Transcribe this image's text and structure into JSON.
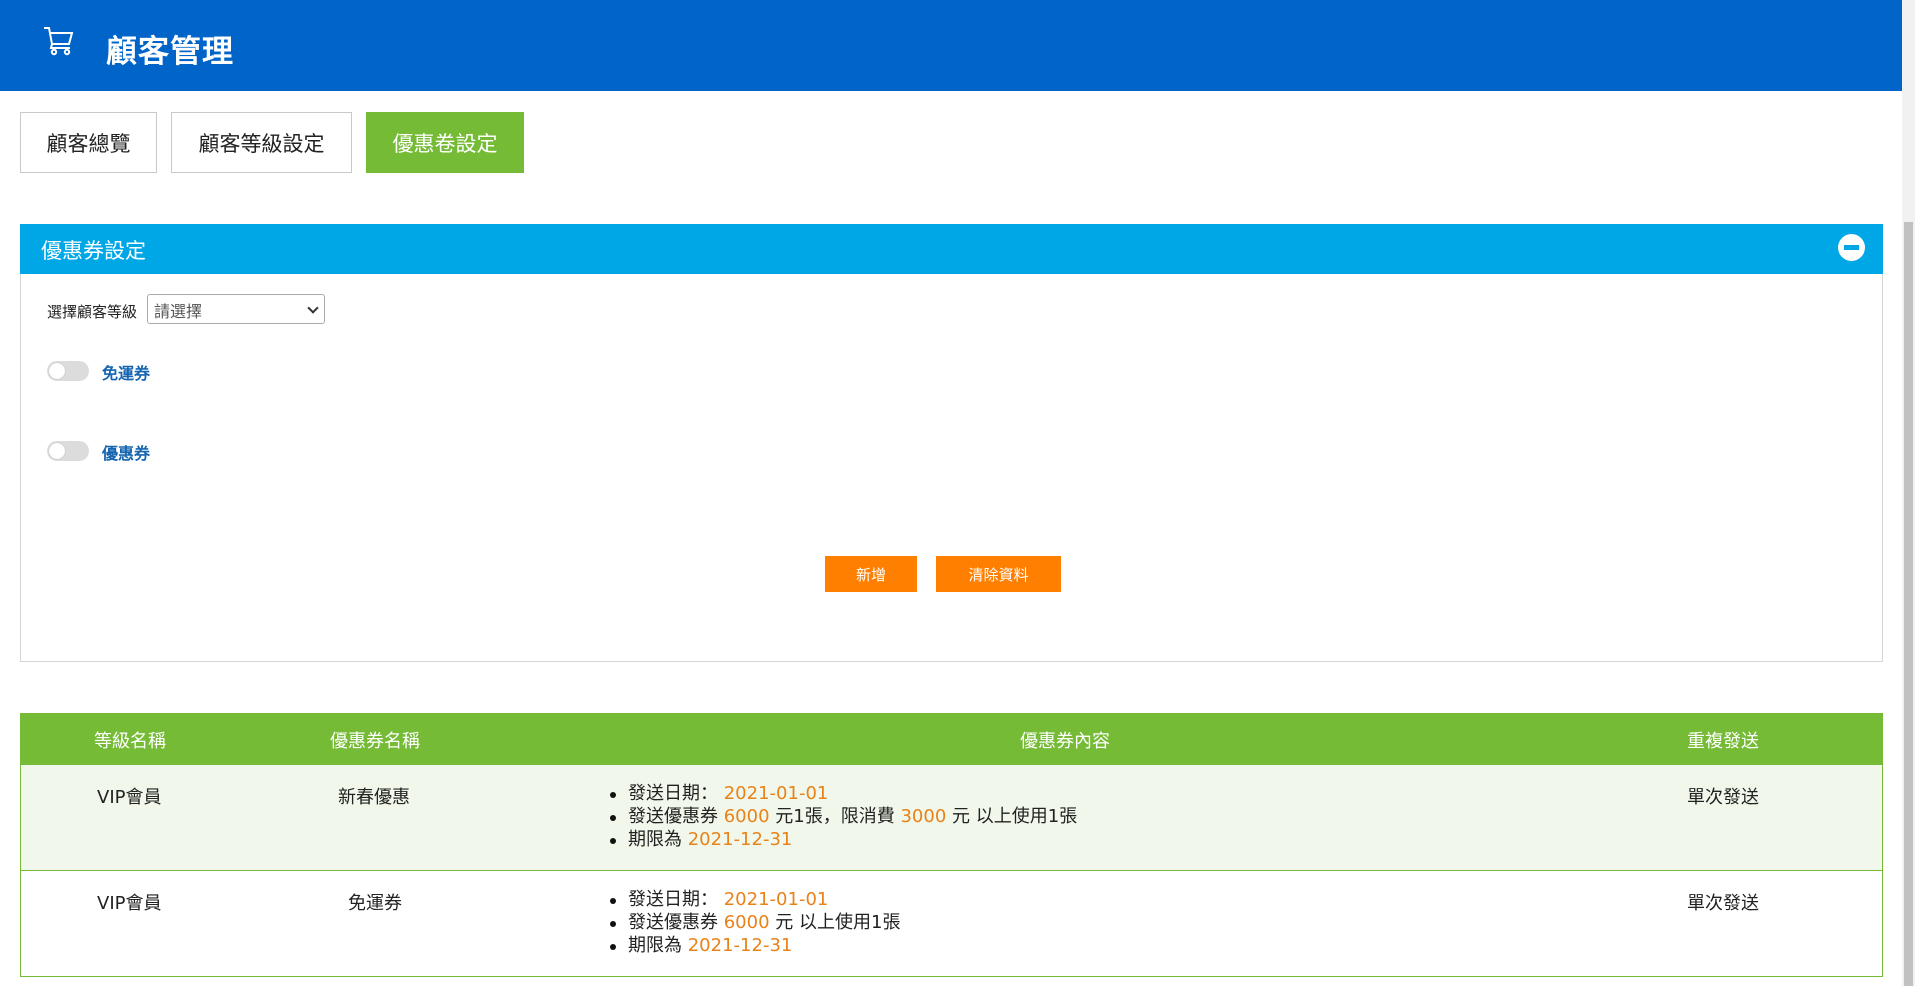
{
  "header": {
    "icon": "cart-icon",
    "title": "顧客管理",
    "bg_color": "#0064c8"
  },
  "tabs": [
    {
      "label": "顧客總覽",
      "active": false
    },
    {
      "label": "顧客等級設定",
      "active": false
    },
    {
      "label": "優惠卷設定",
      "active": true
    }
  ],
  "panel": {
    "title": "優惠券設定",
    "collapse_icon": "minus-circle-icon",
    "level_label": "選擇顧客等級",
    "level_select_value": "請選擇",
    "toggles": [
      {
        "label": "免運券",
        "on": false
      },
      {
        "label": "優惠券",
        "on": false
      }
    ],
    "add_button": "新增",
    "clear_button": "清除資料",
    "header_color": "#00a7e6",
    "button_color": "#ff7f00"
  },
  "table": {
    "header_color": "#75bb36",
    "columns": [
      "等級名稱",
      "優惠券名稱",
      "優惠券內容",
      "重複發送"
    ],
    "rows": [
      {
        "level": "VIP會員",
        "coupon_name": "新春優惠",
        "send_date_label": "發送日期：",
        "send_date": "2021-01-01",
        "amount_prefix": "發送優惠券",
        "amount": "6000",
        "amount_suffix": "元1張，限消費",
        "min_spend": "3000",
        "min_spend_suffix": "元 以上使用1張",
        "expiry_label": "期限為",
        "expiry": "2021-12-31",
        "repeat": "單次發送"
      },
      {
        "level": "VIP會員",
        "coupon_name": "免運券",
        "send_date_label": "發送日期：",
        "send_date": "2021-01-01",
        "amount_prefix": "發送優惠券",
        "amount": "6000",
        "amount_suffix": "元 以上使用1張",
        "expiry_label": "期限為",
        "expiry": "2021-12-31",
        "repeat": "單次發送"
      }
    ]
  }
}
